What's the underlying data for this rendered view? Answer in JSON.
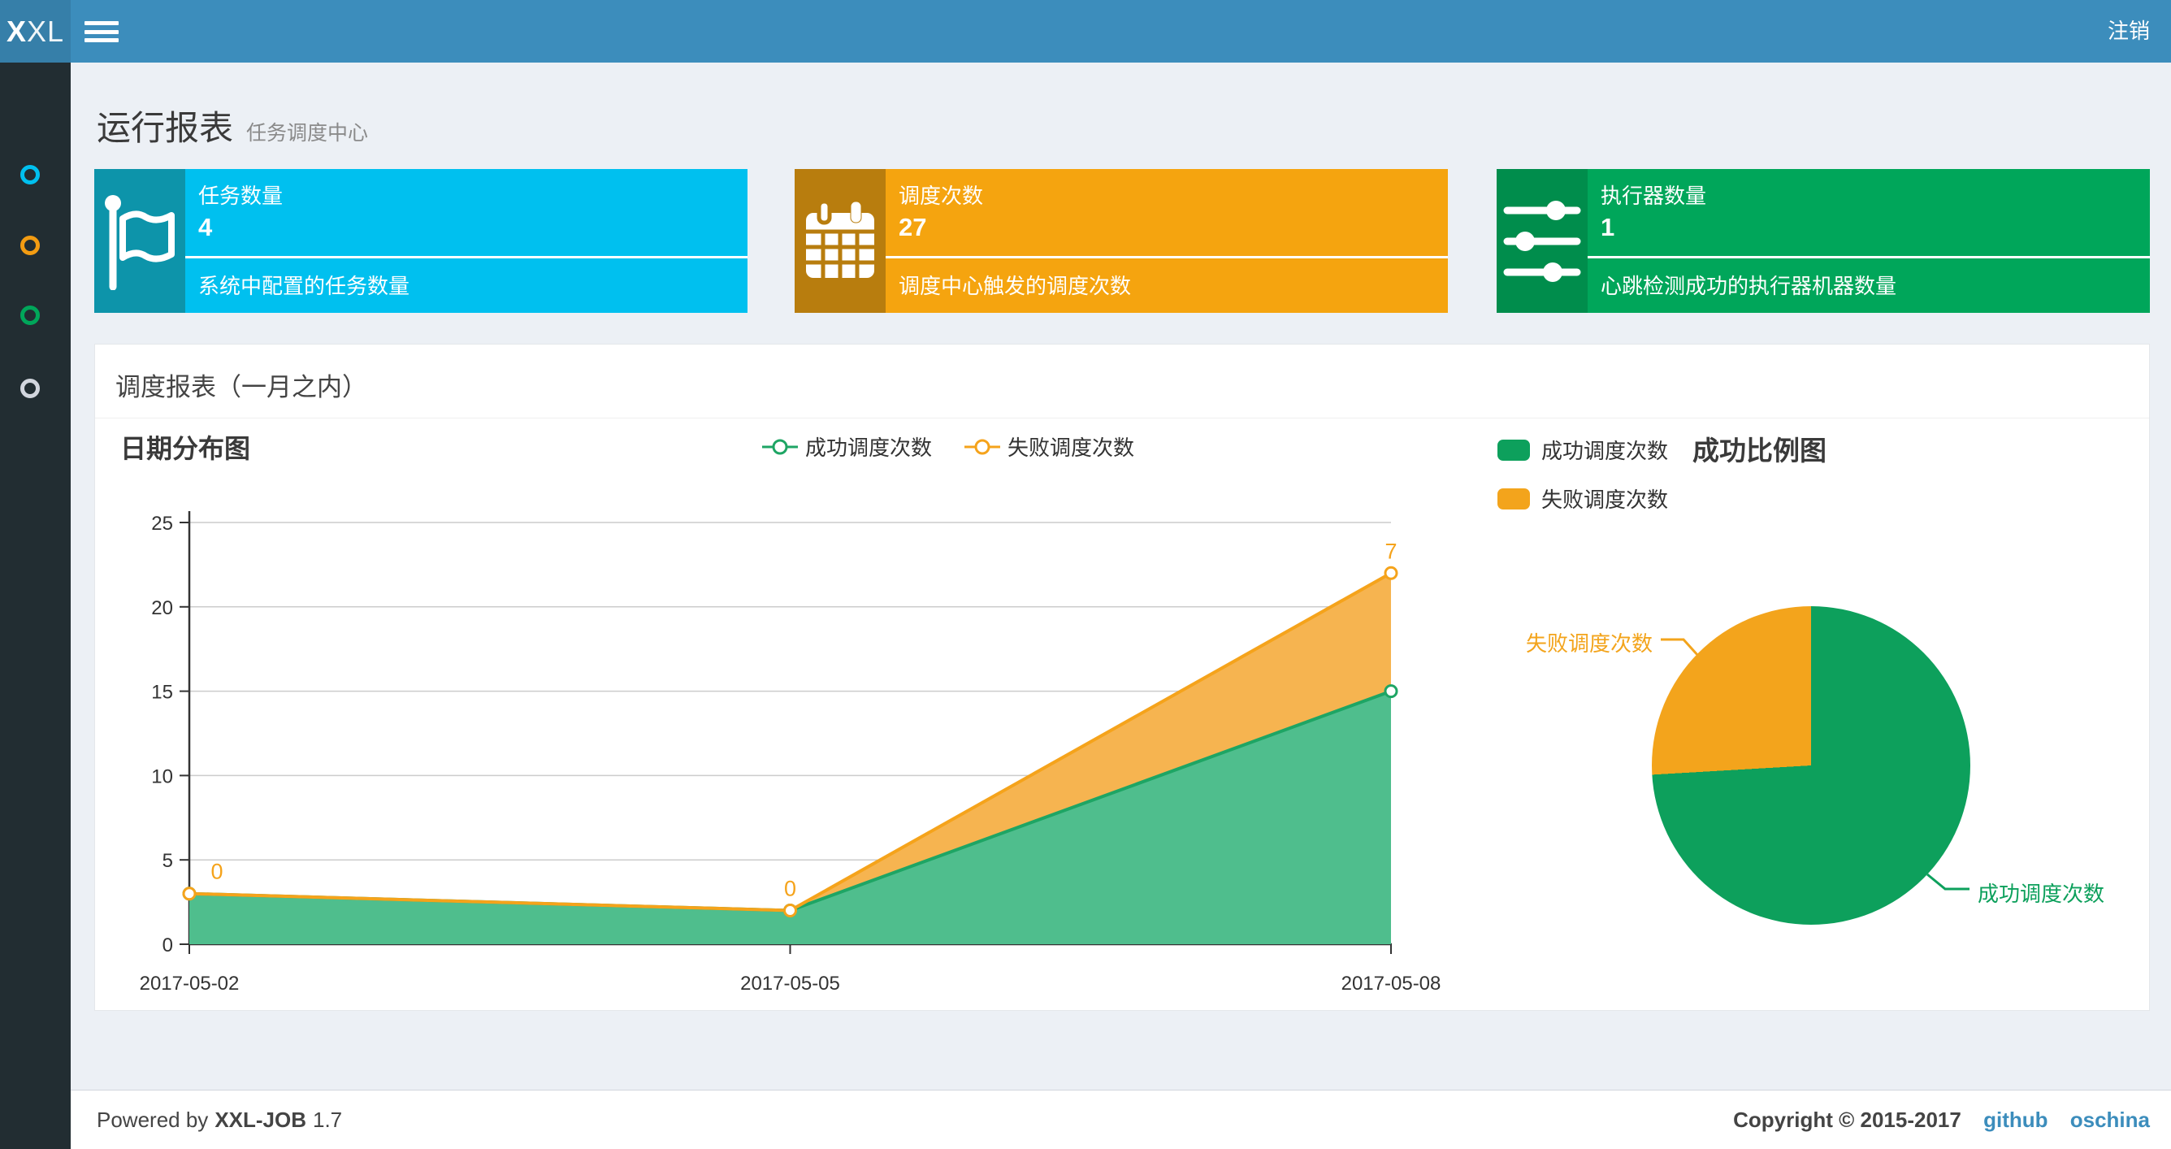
{
  "colors": {
    "navbar-bg": "#3c8dbc",
    "logo-bg": "#367fa9",
    "sidebar-bg": "#222d32",
    "body-bg": "#ecf0f5",
    "link": "#3c8dbc",
    "text-dark": "#3a3a3a",
    "text-gray": "#8a8a8a"
  },
  "navbar": {
    "logo_bold": "X",
    "logo_rest": "XL",
    "logout_label": "注销"
  },
  "sidebar": {
    "items": [
      {
        "icon": "circle-o-icon",
        "color": "#00c0ef"
      },
      {
        "icon": "circle-o-icon",
        "color": "#f39c12"
      },
      {
        "icon": "circle-o-icon",
        "color": "#00a65a"
      },
      {
        "icon": "circle-o-icon",
        "color": "#d2d6de"
      }
    ]
  },
  "page_header": {
    "title": "运行报表",
    "subtitle": "任务调度中心"
  },
  "stat_boxes": [
    {
      "title": "任务数量",
      "value": "4",
      "desc": "系统中配置的任务数量",
      "color": "#00c0ef",
      "icon_bg": "#0d94aa",
      "icon": "flag-icon"
    },
    {
      "title": "调度次数",
      "value": "27",
      "desc": "调度中心触发的调度次数",
      "color": "#f5a40f",
      "icon_bg": "#b87d0e",
      "icon": "calendar-icon"
    },
    {
      "title": "执行器数量",
      "value": "1",
      "desc": "心跳检测成功的执行器机器数量",
      "color": "#00a65a",
      "icon_bg": "#008d4c",
      "icon": "sliders-icon"
    }
  ],
  "panel": {
    "title": "调度报表（一月之内）"
  },
  "chart_data": [
    {
      "type": "area",
      "title": "日期分布图",
      "categories": [
        "2017-05-02",
        "2017-05-05",
        "2017-05-08"
      ],
      "series": [
        {
          "name": "成功调度次数",
          "values": [
            3,
            2,
            15
          ],
          "color": "#1ea564",
          "fill": "#4fbe8d"
        },
        {
          "name": "失败调度次数",
          "values": [
            0,
            0,
            7
          ],
          "color": "#f5a31b",
          "fill": "#f6b450"
        }
      ],
      "stacked": true,
      "point_labels_series": "失败调度次数",
      "point_labels": [
        0,
        0,
        7
      ],
      "xlabel": "",
      "ylabel": "",
      "ylim": [
        0,
        25
      ],
      "yticks": [
        0,
        5,
        10,
        15,
        20,
        25
      ],
      "grid": true,
      "legend_position": "top-center"
    },
    {
      "type": "pie",
      "title": "成功比例图",
      "slices": [
        {
          "name": "成功调度次数",
          "value": 20,
          "color": "#0da05c"
        },
        {
          "name": "失败调度次数",
          "value": 7,
          "color": "#f3a41c"
        }
      ],
      "start_angle": "top",
      "direction": "clockwise",
      "legend_position": "top-left"
    }
  ],
  "footer": {
    "powered_prefix": "Powered by",
    "product": "XXL-JOB",
    "version": "1.7",
    "copyright": "Copyright © 2015-2017",
    "links": [
      {
        "label": "github"
      },
      {
        "label": "oschina"
      }
    ]
  }
}
